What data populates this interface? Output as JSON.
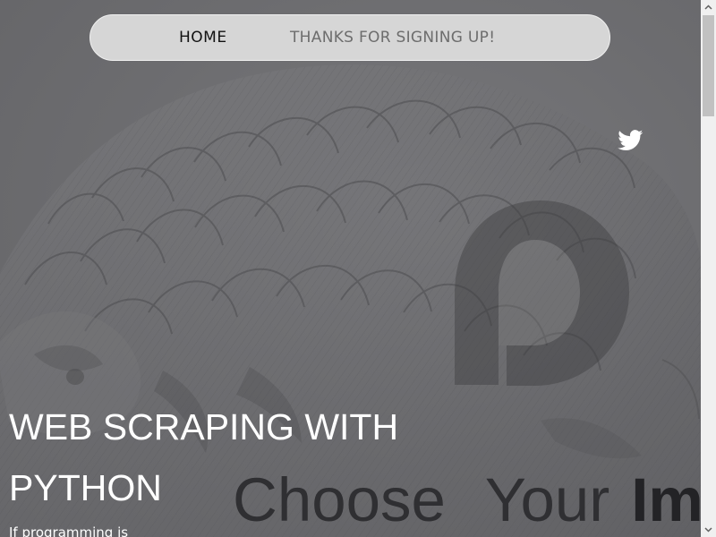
{
  "nav": {
    "items": [
      {
        "label": "HOME"
      },
      {
        "label": "THANKS FOR SIGNING UP!"
      }
    ]
  },
  "social": {
    "icon": "twitter-icon"
  },
  "hero": {
    "title_lines": [
      "WEB SCRAPING WITH",
      "PYTHON"
    ],
    "intro_text": "If programming is"
  },
  "background": {
    "illustration": "pangolin-illustration",
    "logo": "p-logo",
    "cover_text_parts": [
      "Choose",
      "Your",
      "Im"
    ]
  },
  "colors": {
    "nav_background": "#d6d6d6",
    "nav_border": "#f0f0f0",
    "active_nav_text": "#121212",
    "inactive_nav_text": "#6d6d6d",
    "hero_background": "#6b6b6e",
    "hero_text": "#ffffff",
    "cover_text": "#2f2f32"
  }
}
